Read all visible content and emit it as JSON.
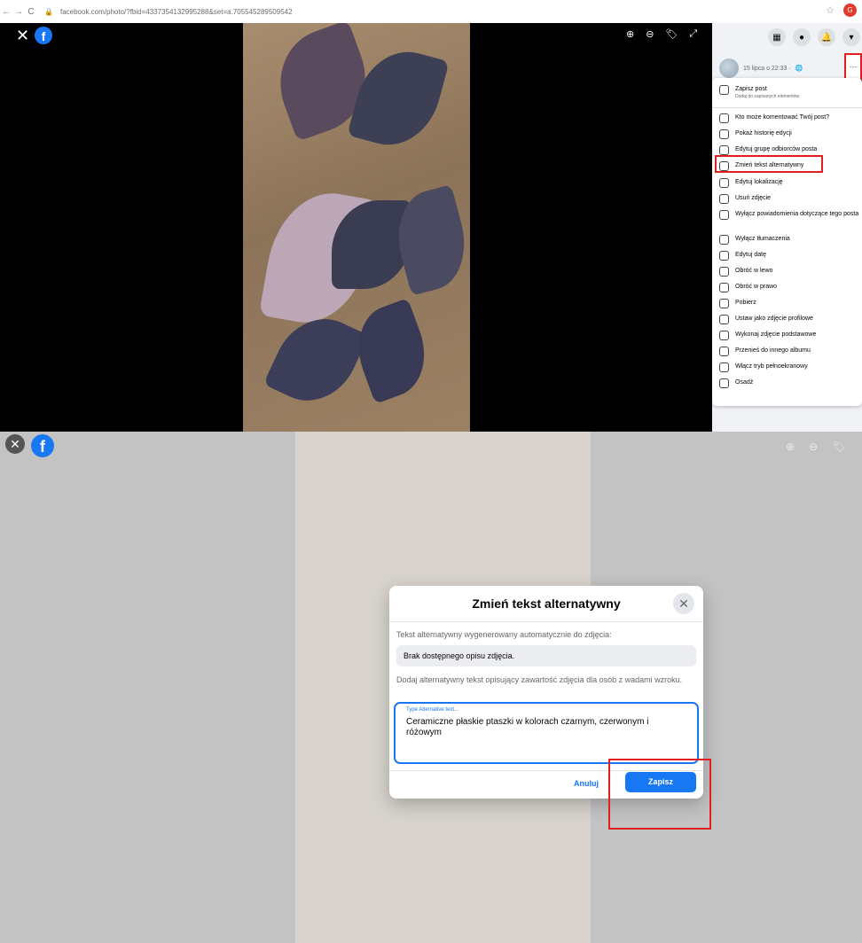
{
  "browser": {
    "url": "facebook.com/photo/?fbid=4337354132995288&set=a.705545289509542",
    "nav": [
      "←",
      "→",
      "C"
    ],
    "ext_badge": "G"
  },
  "viewer": {
    "close": "✕",
    "logo": "f",
    "tools": [
      "⊕",
      "⊖",
      "🏷",
      "⤢"
    ]
  },
  "sidebar": {
    "top_icons": [
      "▦",
      "●",
      "🔔",
      "▾"
    ],
    "post_date": "15 lipca o 22:33 · ",
    "more": "···"
  },
  "menu": {
    "save_post": "Zapisz post",
    "save_post_sub": "Dodaj do zapisanych elementów.",
    "items": [
      "Kto może komentować Twój post?",
      "Pokaż historię edycji",
      "Edytuj grupę odbiorców posta",
      "Zmień tekst alternatywny",
      "Edytuj lokalizację",
      "Usuń zdjęcie",
      "Wyłącz powiadomienia dotyczące tego posta",
      "Wyłącz tłumaczenia",
      "Edytuj datę",
      "Obróć w lewo",
      "Obróć w prawo",
      "Pobierz",
      "Ustaw jako zdjęcie profilowe",
      "Wykonaj zdjęcie podstawowe",
      "Przenieś do innego albumu",
      "Włącz tryb pełnoekranowy",
      "Osadź"
    ]
  },
  "dialog": {
    "title": "Zmień tekst alternatywny",
    "close": "✕",
    "generated_label": "Tekst alternatywny wygenerowany automatycznie do zdjęcia:",
    "generated_value": "Brak dostępnego opisu zdjęcia.",
    "add_label": "Dodaj alternatywny tekst opisujący zawartość zdjęcia dla osób z wadami wzroku.",
    "field_placeholder": "Type Alternative text...",
    "field_value": "Ceramiczne płaskie ptaszki w kolorach czarnym, czerwonym i różowym",
    "cancel": "Anuluj",
    "save": "Zapisz"
  },
  "colors": {
    "brand": "#1877f2",
    "highlight": "#e02020"
  }
}
